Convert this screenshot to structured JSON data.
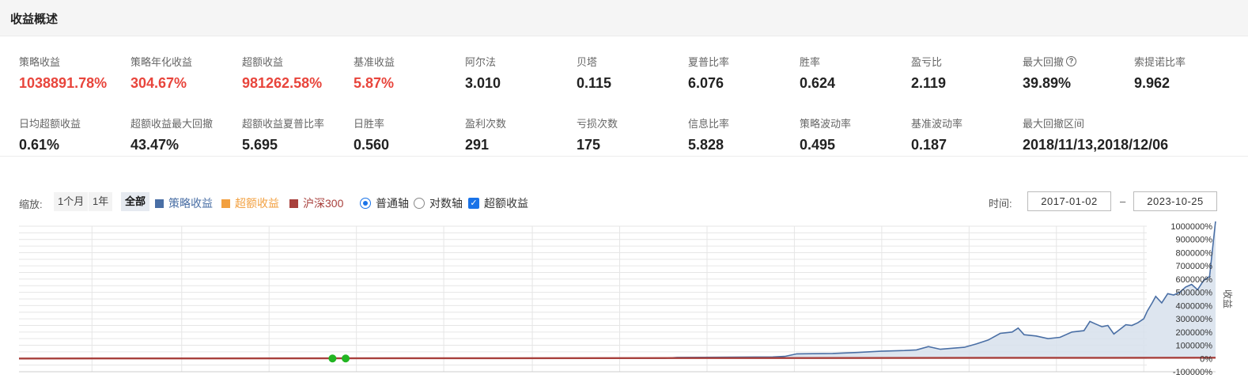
{
  "header": {
    "title": "收益概述"
  },
  "metrics": [
    {
      "label": "策略收益",
      "value": "1038891.78%",
      "red": true
    },
    {
      "label": "策略年化收益",
      "value": "304.67%",
      "red": true
    },
    {
      "label": "超额收益",
      "value": "981262.58%",
      "red": true
    },
    {
      "label": "基准收益",
      "value": "5.87%",
      "red": true
    },
    {
      "label": "阿尔法",
      "value": "3.010",
      "red": false
    },
    {
      "label": "贝塔",
      "value": "0.115",
      "red": false
    },
    {
      "label": "夏普比率",
      "value": "6.076",
      "red": false
    },
    {
      "label": "胜率",
      "value": "0.624",
      "red": false
    },
    {
      "label": "盈亏比",
      "value": "2.119",
      "red": false
    },
    {
      "label": "最大回撤",
      "value": "39.89%",
      "red": false,
      "help": true,
      "help_icon": "question-circle-icon"
    },
    {
      "label": "索提诺比率",
      "value": "9.962",
      "red": false
    },
    {
      "label": "日均超额收益",
      "value": "0.61%",
      "red": false
    },
    {
      "label": "超额收益最大回撤",
      "value": "43.47%",
      "red": false
    },
    {
      "label": "超额收益夏普比率",
      "value": "5.695",
      "red": false
    },
    {
      "label": "日胜率",
      "value": "0.560",
      "red": false
    },
    {
      "label": "盈利次数",
      "value": "291",
      "red": false
    },
    {
      "label": "亏损次数",
      "value": "175",
      "red": false
    },
    {
      "label": "信息比率",
      "value": "5.828",
      "red": false
    },
    {
      "label": "策略波动率",
      "value": "0.495",
      "red": false
    },
    {
      "label": "基准波动率",
      "value": "0.187",
      "red": false
    },
    {
      "label": "最大回撤区间",
      "value": "2018/11/13,2018/12/06",
      "red": false
    }
  ],
  "toolbar": {
    "zoom_label": "缩放:",
    "zoom_options": [
      "1个月",
      "1年",
      "全部"
    ],
    "zoom_active": "全部",
    "legend": [
      {
        "name": "策略收益",
        "color": "#4a6fa5"
      },
      {
        "name": "超额收益",
        "color": "#f2a040"
      },
      {
        "name": "沪深300",
        "color": "#a8403c"
      }
    ],
    "axis_normal": "普通轴",
    "axis_log": "对数轴",
    "excess_toggle": "超额收益",
    "check_mark": "✓",
    "time_label": "时间:",
    "start_date": "2017-01-02",
    "date_separator": "–",
    "end_date": "2023-10-25"
  },
  "chart_data": {
    "type": "area",
    "ylabel": "收益",
    "y_ticks": [
      "1000000%",
      "900000%",
      "800000%",
      "700000%",
      "600000%",
      "500000%",
      "400000%",
      "300000%",
      "200000%",
      "100000%",
      "0%",
      "-100000%"
    ],
    "ylim": [
      -100000,
      1000000
    ],
    "x_range": [
      "2017-01-02",
      "2023-10-25"
    ],
    "grid": true,
    "series": [
      {
        "name": "策略收益",
        "color": "#4a6fa5",
        "fill": "#d7e0ec",
        "points": [
          [
            0.0,
            0
          ],
          [
            0.54,
            2000
          ],
          [
            0.55,
            8000
          ],
          [
            0.6,
            10000
          ],
          [
            0.63,
            12000
          ],
          [
            0.64,
            16000
          ],
          [
            0.65,
            35000
          ],
          [
            0.68,
            38000
          ],
          [
            0.7,
            45000
          ],
          [
            0.72,
            55000
          ],
          [
            0.74,
            60000
          ],
          [
            0.75,
            65000
          ],
          [
            0.76,
            90000
          ],
          [
            0.77,
            70000
          ],
          [
            0.79,
            85000
          ],
          [
            0.8,
            110000
          ],
          [
            0.81,
            140000
          ],
          [
            0.82,
            190000
          ],
          [
            0.83,
            200000
          ],
          [
            0.835,
            230000
          ],
          [
            0.84,
            180000
          ],
          [
            0.85,
            170000
          ],
          [
            0.86,
            150000
          ],
          [
            0.87,
            160000
          ],
          [
            0.88,
            200000
          ],
          [
            0.89,
            210000
          ],
          [
            0.895,
            280000
          ],
          [
            0.9,
            260000
          ],
          [
            0.905,
            240000
          ],
          [
            0.91,
            250000
          ],
          [
            0.915,
            185000
          ],
          [
            0.92,
            220000
          ],
          [
            0.925,
            255000
          ],
          [
            0.93,
            250000
          ],
          [
            0.935,
            270000
          ],
          [
            0.94,
            300000
          ],
          [
            0.943,
            360000
          ],
          [
            0.947,
            420000
          ],
          [
            0.95,
            470000
          ],
          [
            0.955,
            420000
          ],
          [
            0.96,
            490000
          ],
          [
            0.965,
            480000
          ],
          [
            0.97,
            500000
          ],
          [
            0.975,
            540000
          ],
          [
            0.98,
            560000
          ],
          [
            0.985,
            520000
          ],
          [
            0.99,
            590000
          ],
          [
            0.995,
            620000
          ],
          [
            1.0,
            1040000
          ]
        ]
      },
      {
        "name": "沪深300",
        "color": "#a8403c",
        "points": [
          [
            0.0,
            0
          ],
          [
            1.0,
            5870
          ]
        ]
      }
    ],
    "markers": [
      {
        "x": 0.262,
        "y": 0,
        "color": "#22b522"
      },
      {
        "x": 0.273,
        "y": 0,
        "color": "#22b522"
      }
    ]
  }
}
